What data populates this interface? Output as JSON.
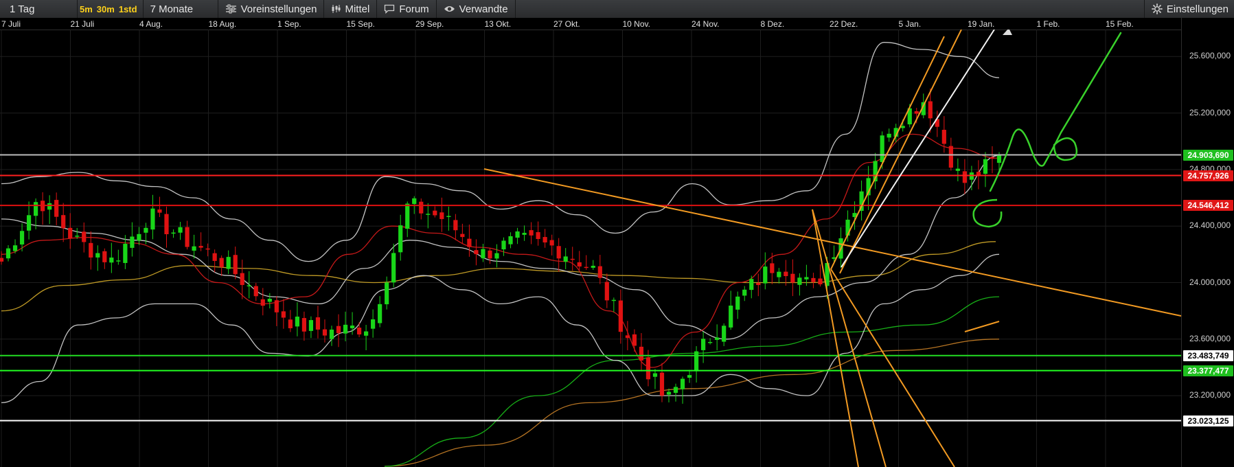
{
  "toolbar": {
    "period": "1 Tag",
    "quick_intervals": [
      "5m",
      "30m",
      "1std"
    ],
    "range": "7 Monate",
    "presets": "Voreinstellungen",
    "indicator": "Mittel",
    "forum": "Forum",
    "related": "Verwandte",
    "settings": "Einstellungen"
  },
  "time_axis": [
    "7 Juli",
    "21 Juli",
    "4 Aug.",
    "18 Aug.",
    "1 Sep.",
    "15 Sep.",
    "29 Sep.",
    "13 Okt.",
    "27 Okt.",
    "10 Nov.",
    "24 Nov.",
    "8 Dez.",
    "22 Dez.",
    "5 Jan.",
    "19 Jan.",
    "1 Feb.",
    "15 Feb."
  ],
  "price_axis": [
    "25.600,000",
    "25.200,000",
    "24.800,000",
    "24.400,000",
    "24.000,000",
    "23.600,000",
    "23.200,000"
  ],
  "price_tags": [
    {
      "label": "24.903,690",
      "price": 24903.69,
      "bg": "#1fbf1f",
      "fg": "#ffffff",
      "line": "#bbbbbb"
    },
    {
      "label": "24.757,926",
      "price": 24757.926,
      "bg": "#e01616",
      "fg": "#ffffff",
      "line": "#ff2020"
    },
    {
      "label": "24.546,412",
      "price": 24546.412,
      "bg": "#e01616",
      "fg": "#ffffff",
      "line": "#e01010"
    },
    {
      "label": "23.483,749",
      "price": 23483.749,
      "bg": "#ffffff",
      "fg": "#000000",
      "line": "#22dd22"
    },
    {
      "label": "23.377,477",
      "price": 23377.477,
      "bg": "#1fbf1f",
      "fg": "#ffffff",
      "line": "#22ff22"
    },
    {
      "label": "23.023,125",
      "price": 23023.125,
      "bg": "#ffffff",
      "fg": "#000000",
      "line": "#ffffff"
    }
  ],
  "colors": {
    "background": "#000000",
    "toolbar": "#333538",
    "accent": "#ffd21a",
    "up_candle": "#19d619",
    "down_candle": "#e01212",
    "grid": "#1e1e1e",
    "trendline_orange": "#f29a22",
    "drawing_green": "#39d12b",
    "bollinger": "#cfcfcf",
    "sma_fast": "#d11a1a",
    "sma_mid": "#c9a227",
    "sma_slow": "#18b818",
    "sma_long": "#c07a25"
  },
  "chart_data": {
    "type": "candlestick",
    "x": [
      "7 Juli",
      "21 Juli",
      "4 Aug.",
      "18 Aug.",
      "1 Sep.",
      "15 Sep.",
      "29 Sep.",
      "13 Okt.",
      "27 Okt.",
      "10 Nov.",
      "24 Nov.",
      "8 Dez.",
      "22 Dez.",
      "5 Jan.",
      "19 Jan.",
      "1 Feb.",
      "15 Feb."
    ],
    "ylim": [
      22700,
      25820
    ],
    "y_ticks": [
      25600,
      25200,
      24800,
      24400,
      24000,
      23600,
      23200
    ],
    "close_path": [
      24150,
      24600,
      24300,
      24150,
      24480,
      24300,
      24150,
      23900,
      23700,
      23650,
      23700,
      24550,
      24450,
      24200,
      24300,
      24250,
      24100,
      23600,
      23150,
      23550,
      23900,
      24150,
      23950,
      24500,
      25100,
      25300,
      24700,
      24880
    ],
    "indicators": {
      "bollinger_upper": [
        24700,
        24750,
        24780,
        24720,
        24680,
        24600,
        24450,
        24300,
        24150,
        24300,
        24750,
        24700,
        24650,
        24520,
        24580,
        24480,
        24350,
        24500,
        24700,
        24550,
        24580,
        24650,
        25050,
        25700,
        25650,
        25600,
        25450
      ],
      "bollinger_lower": [
        23150,
        23300,
        23700,
        23750,
        23850,
        23850,
        23700,
        23500,
        23480,
        23650,
        23950,
        24050,
        23950,
        23850,
        23900,
        23700,
        23450,
        23200,
        23200,
        23350,
        23250,
        23200,
        23500,
        23850,
        23950,
        24050,
        24200
      ],
      "bollinger_mid": [
        24450,
        24400,
        24350,
        24300,
        24200,
        24050,
        23900,
        23850,
        24100,
        24300,
        24250,
        24150,
        24100,
        24050,
        23950,
        23700,
        23600,
        23750,
        23900,
        24000,
        24200,
        24600,
        24900
      ],
      "sma_fast": [
        24200,
        24300,
        24320,
        24280,
        24200,
        24000,
        23850,
        23900,
        24200,
        24400,
        24350,
        24250,
        24200,
        24150,
        23800,
        23400,
        23650,
        24000,
        24200,
        24450,
        24850,
        25050,
        24950,
        24880
      ],
      "sma_mid": [
        23800,
        23980,
        24020,
        24120,
        24100,
        24050,
        24000,
        24050,
        24100,
        24080,
        24050,
        24030,
        24000,
        24000,
        24050,
        24200,
        24290
      ],
      "sma_slow": [
        22700,
        22900,
        23200,
        23450,
        23500,
        23550,
        23650,
        23700,
        23900
      ],
      "sma_long": [
        22700,
        22850,
        23150,
        23250,
        23350,
        23520,
        23600
      ]
    },
    "price_lines": [
      24903.69,
      24757.926,
      24546.412,
      23483.749,
      23377.477,
      23023.125
    ],
    "grid": true
  }
}
